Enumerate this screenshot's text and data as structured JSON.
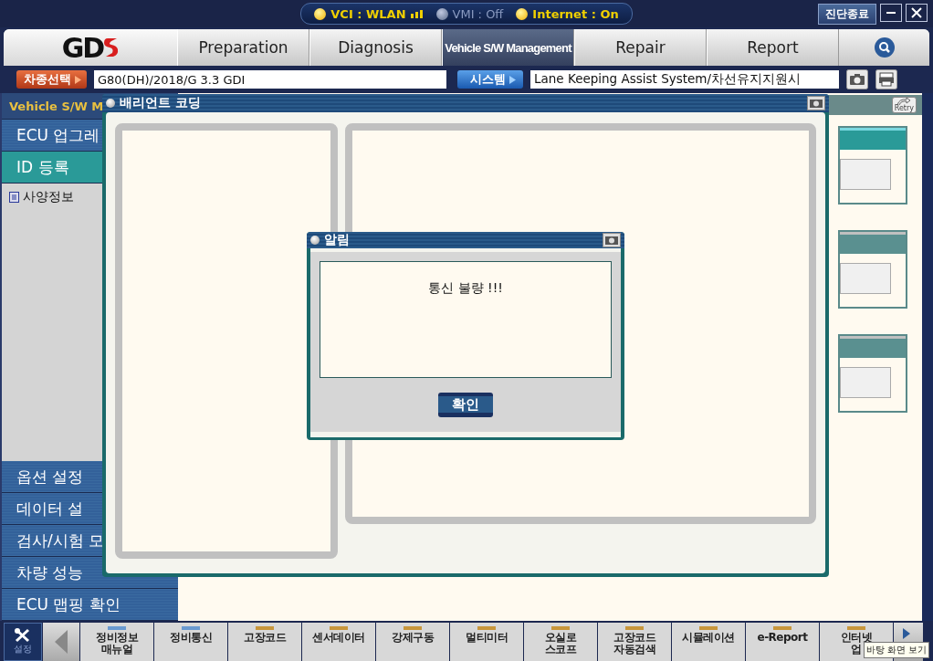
{
  "status_bar": {
    "items": [
      {
        "label": "VCI : WLAN",
        "on": true,
        "signal": true
      },
      {
        "label": "VMI : Off",
        "on": false,
        "signal": false
      },
      {
        "label": "Internet : On",
        "on": true,
        "signal": false
      }
    ],
    "end_button": "진단종료"
  },
  "logo": {
    "text": "GD"
  },
  "tabs": [
    {
      "label": "Preparation",
      "selected": false
    },
    {
      "label": "Diagnosis",
      "selected": false
    },
    {
      "label": "Vehicle S/W Management",
      "selected": true
    },
    {
      "label": "Repair",
      "selected": false
    },
    {
      "label": "Report",
      "selected": false
    }
  ],
  "vehicle": {
    "button": "차종선택",
    "value": "G80(DH)/2018/G 3.3 GDI",
    "system_button": "시스템",
    "system_value": "Lane Keeping Assist System/차선유지지원시"
  },
  "sidebar": {
    "heading": "Vehicle S/W M",
    "items": [
      {
        "label": "ECU 업그레",
        "selected": false
      },
      {
        "label": "ID 등록",
        "selected": true,
        "children": [
          {
            "label": "사양정보"
          }
        ]
      },
      {
        "label": "옵션 설정",
        "selected": false
      },
      {
        "label": "데이터 설",
        "selected": false
      },
      {
        "label": "검사/시험 모",
        "selected": false
      },
      {
        "label": "차량 성능",
        "selected": false
      },
      {
        "label": "ECU 맵핑 확인",
        "selected": false
      }
    ]
  },
  "content": {
    "retry": "Retry"
  },
  "variant_window": {
    "title": "배리언트 코딩"
  },
  "alert": {
    "title": "알림",
    "message": "통신 불량 !!!",
    "ok": "확인"
  },
  "toolbar": {
    "settings": "설정",
    "items": [
      {
        "label": "정비정보\n매뉴얼",
        "color": "#6a9ad0"
      },
      {
        "label": "정비통신",
        "color": "#6a9ad0"
      },
      {
        "label": "고장코드",
        "color": "#c8963c"
      },
      {
        "label": "센서데이터",
        "color": "#c8963c"
      },
      {
        "label": "강제구동",
        "color": "#c8963c"
      },
      {
        "label": "멀티미터",
        "color": "#c8963c"
      },
      {
        "label": "오실로\n스코프",
        "color": "#c8963c"
      },
      {
        "label": "고장코드\n자동검색",
        "color": "#c8963c"
      },
      {
        "label": "시뮬레이션",
        "color": "#c8963c"
      },
      {
        "label": "e-Report",
        "color": "#c8963c"
      },
      {
        "label": "인터넷\n업",
        "color": "#c8963c"
      }
    ]
  },
  "tooltip": "바탕 화면 보기"
}
